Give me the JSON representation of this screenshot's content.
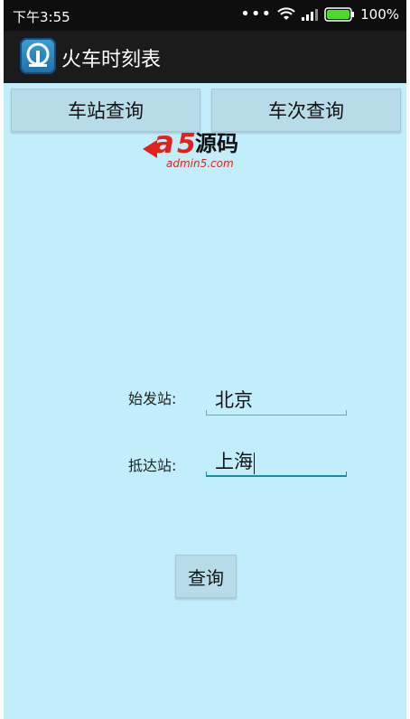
{
  "status_bar": {
    "time": "下午3:55",
    "signal_icon": "signal-bars-icon",
    "wifi_icon": "wifi-icon",
    "battery_icon": "battery-icon",
    "battery_level": 1.0,
    "battery_percent": "100%"
  },
  "app_bar": {
    "title": "火车时刻表",
    "icon": "train-logo-icon"
  },
  "tabs": [
    {
      "label": "车站查询"
    },
    {
      "label": "车次查询"
    }
  ],
  "watermark": {
    "logo_text": "a5源码",
    "domain": "admin5.com",
    "color": "#e2211c"
  },
  "form": {
    "origin": {
      "label": "始发站:",
      "value": "北京"
    },
    "destination": {
      "label": "抵达站:",
      "value": "上海"
    },
    "submit_label": "查询"
  },
  "colors": {
    "background": "#c2eefc",
    "button": "#b7dce8",
    "focus_underline": "#1a8ba6",
    "battery": "#4cd92b"
  }
}
